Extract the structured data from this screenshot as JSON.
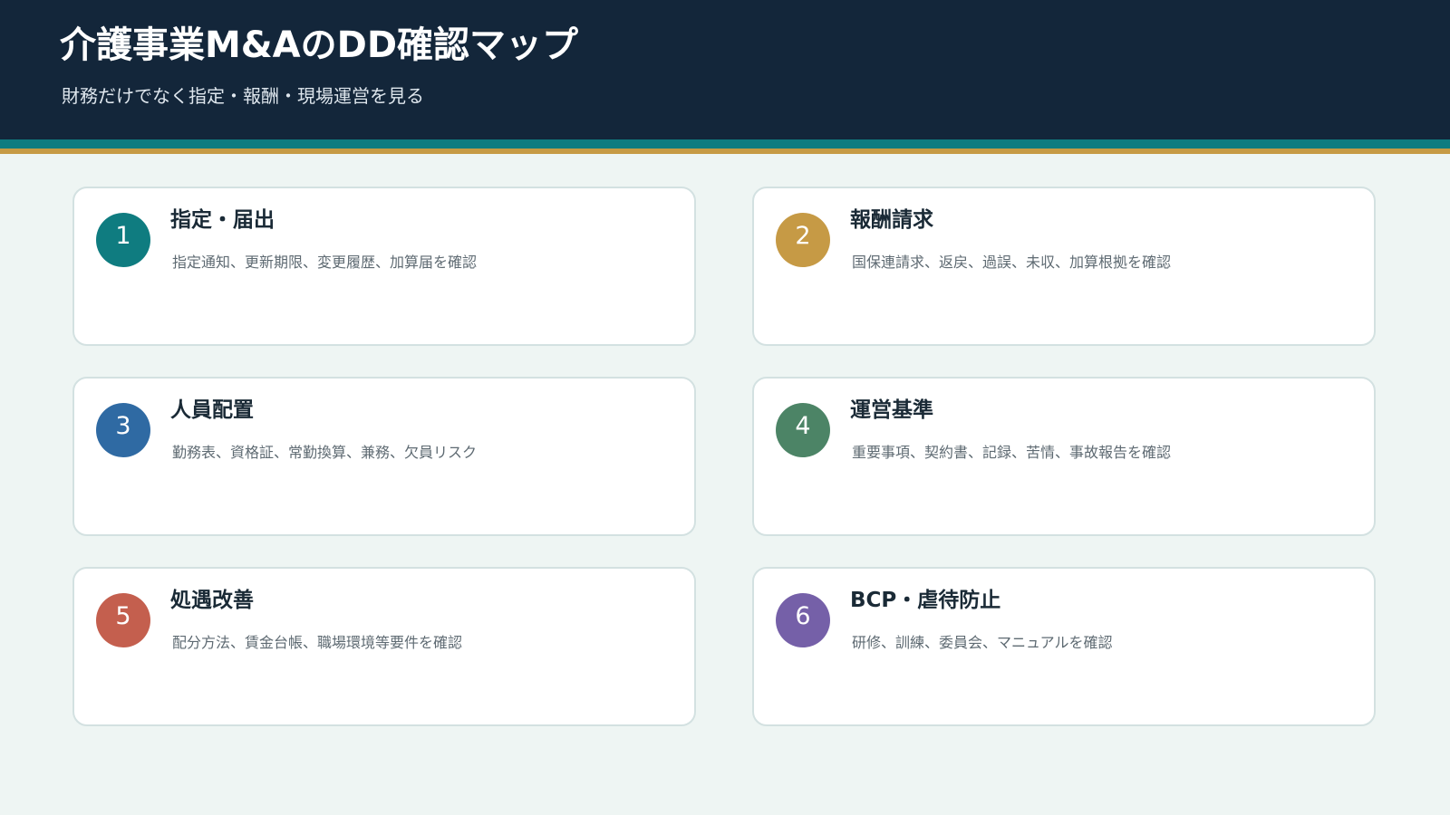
{
  "header": {
    "title": "介護事業M&AのDD確認マップ",
    "subtitle": "財務だけでなく指定・報酬・現場運営を見る"
  },
  "colors": {
    "header_bg": "#13263a",
    "stripe_teal": "#0f7c80",
    "stripe_gold": "#c69a45",
    "page_bg": "#eef5f3"
  },
  "cards": [
    {
      "number": "1",
      "title": "指定・届出",
      "description": "指定通知、更新期限、変更履歴、加算届を確認",
      "color": "#0f7c80"
    },
    {
      "number": "2",
      "title": "報酬請求",
      "description": "国保連請求、返戻、過誤、未収、加算根拠を確認",
      "color": "#c69a45"
    },
    {
      "number": "3",
      "title": "人員配置",
      "description": "勤務表、資格証、常勤換算、兼務、欠員リスク",
      "color": "#2f6aa3"
    },
    {
      "number": "4",
      "title": "運営基準",
      "description": "重要事項、契約書、記録、苦情、事故報告を確認",
      "color": "#4c8466"
    },
    {
      "number": "5",
      "title": "処遇改善",
      "description": "配分方法、賃金台帳、職場環境等要件を確認",
      "color": "#c45f4e"
    },
    {
      "number": "6",
      "title": "BCP・虐待防止",
      "description": "研修、訓練、委員会、マニュアルを確認",
      "color": "#7560a8"
    }
  ]
}
